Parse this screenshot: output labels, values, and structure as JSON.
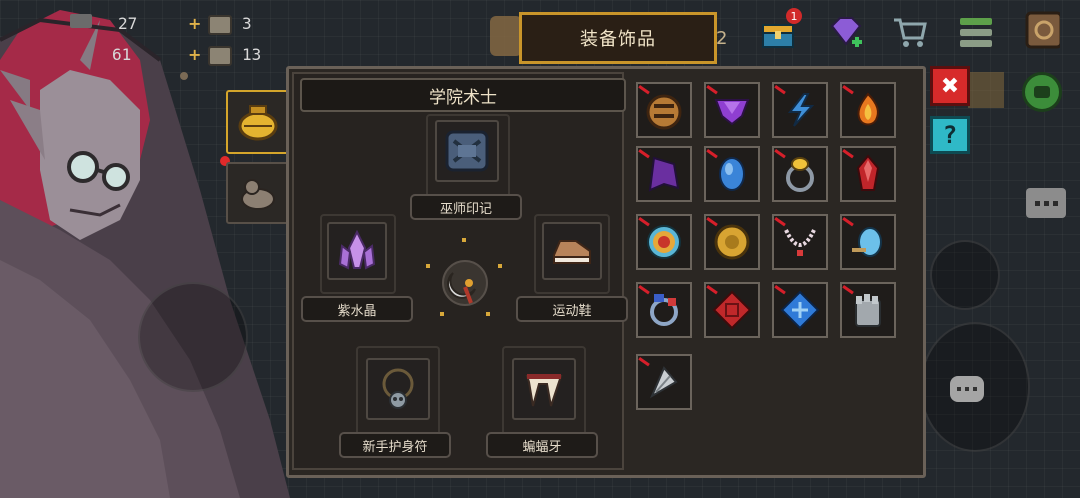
{
  "hud": {
    "row1_left_value": "27",
    "row1_right_value": "3",
    "row2_left_value": "61",
    "row2_right_value": "13",
    "plus_sign": "+"
  },
  "title_tab": "装备饰品",
  "notification_count": "1",
  "panel": {
    "character_name": "学院术士",
    "equipped": {
      "top": "巫师印记",
      "left": "紫水晶",
      "right": "运动鞋",
      "bottom_left": "新手护身符",
      "bottom_right": "蝙蝠牙"
    }
  },
  "close_button_label": "✖",
  "help_button_label": "?",
  "icons": {
    "gem": "gem-plus-icon",
    "cart": "shopping-cart-icon",
    "menu": "menu-list-icon",
    "chest": "chest-icon",
    "bag": "bag-icon",
    "chat": "chat-icon",
    "emote": "emote-icon",
    "close": "close-icon",
    "help": "help-icon"
  },
  "colors": {
    "accent_gold": "#c9952a",
    "close_red": "#d72a2a",
    "help_cyan": "#2fb9c7",
    "panel_bg": "#2b2723",
    "item_tag_red": "#d61f2a"
  },
  "inventory": [
    "bronze-coin-bag-icon",
    "purple-gem-icon",
    "blue-lightning-icon",
    "fire-gem-icon",
    "purple-cloak-icon",
    "blue-sapphire-icon",
    "gold-ring-icon",
    "red-crystal-icon",
    "target-medallion-icon",
    "gold-medallion-icon",
    "pearl-necklace-icon",
    "blue-egg-icon",
    "blue-ring-icon",
    "red-rune-icon",
    "blue-rune-icon",
    "iron-gauntlet-icon",
    "silver-feather-icon"
  ]
}
